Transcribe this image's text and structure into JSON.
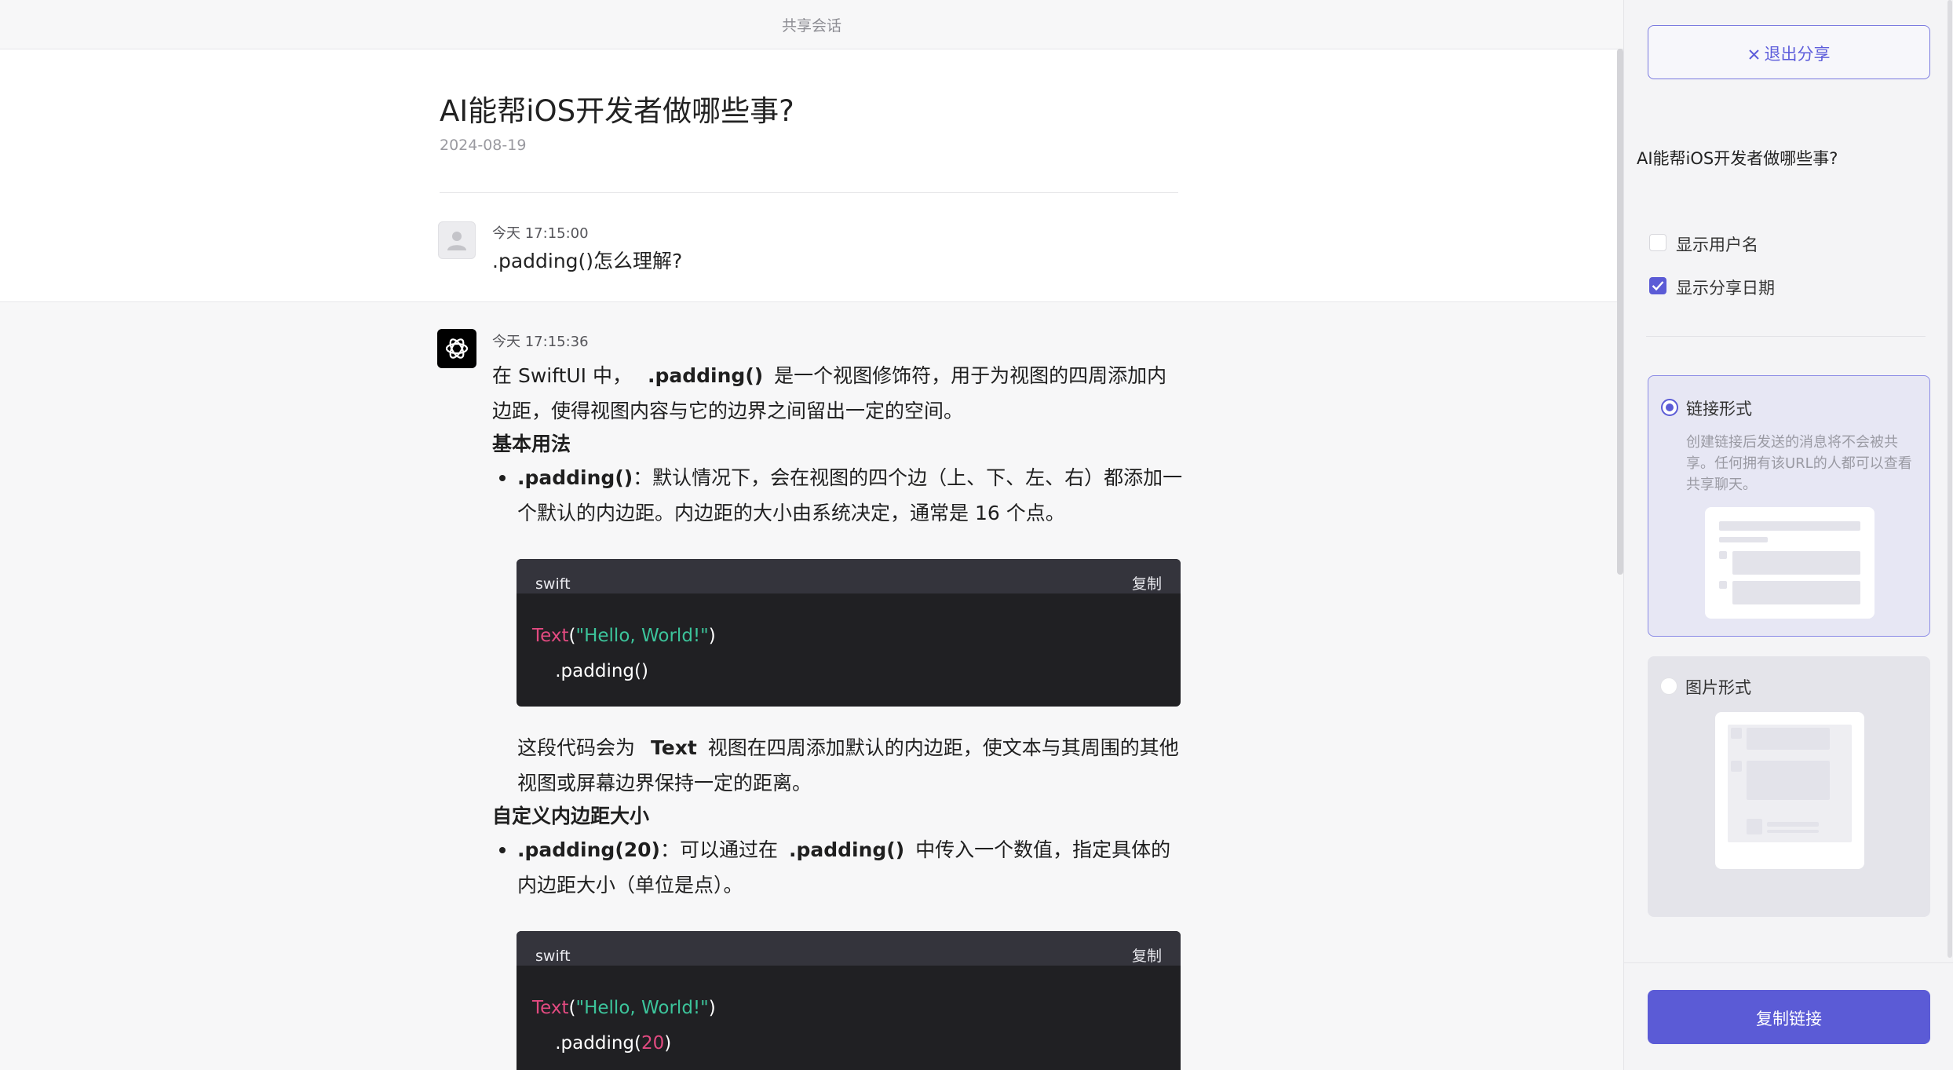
{
  "header": {
    "title": "共享会话"
  },
  "conversation": {
    "title": "AI能帮iOS开发者做哪些事?",
    "date": "2024-08-19"
  },
  "user_message": {
    "time": "今天 17:15:00",
    "text": ".padding()怎么理解?"
  },
  "ai_message": {
    "time": "今天 17:15:36",
    "intro_pre": "在 SwiftUI 中，",
    "intro_code": ".padding()",
    "intro_post": "是一个视图修饰符，用于为视图的四周添加内边距，使得视图内容与它的边界之间留出一定的空间。",
    "heading_basic": "基本用法",
    "bullet1_code": ".padding()",
    "bullet1_text": "：默认情况下，会在视图的四个边（上、下、左、右）都添加一个默认的内边距。内边距的大小由系统决定，通常是 16 个点。",
    "code1": {
      "lang": "swift",
      "copy": "复制",
      "line1_type": "Text",
      "line1_open": "(",
      "line1_str": "\"Hello, World!\"",
      "line1_close": ")",
      "line2": "    .padding()"
    },
    "para2_pre": "这段代码会为",
    "para2_code": "Text",
    "para2_post": "视图在四周添加默认的内边距，使文本与其周围的其他视图或屏幕边界保持一定的距离。",
    "heading_custom": "自定义内边距大小",
    "bullet2_code": ".padding(20)",
    "bullet2_pre": "：可以通过在",
    "bullet2_code2": ".padding()",
    "bullet2_post": "中传入一个数值，指定具体的内边距大小（单位是点）。",
    "code2": {
      "lang": "swift",
      "copy": "复制",
      "line1_type": "Text",
      "line1_open": "(",
      "line1_str": "\"Hello, World!\"",
      "line1_close": ")",
      "line2_pre": "    .padding(",
      "line2_num": "20",
      "line2_post": ")"
    }
  },
  "panel": {
    "exit_label": "退出分享",
    "title": "AI能帮iOS开发者做哪些事?",
    "show_username": {
      "label": "显示用户名",
      "checked": false
    },
    "show_date": {
      "label": "显示分享日期",
      "checked": true
    },
    "link_option": {
      "label": "链接形式",
      "selected": true,
      "description": "创建链接后发送的消息将不会被共享。任何拥有该URL的人都可以查看共享聊天。"
    },
    "image_option": {
      "label": "图片形式",
      "selected": false
    },
    "copy_link_label": "复制链接"
  },
  "colors": {
    "accent": "#5b5bd6",
    "code_bg": "#202023",
    "code_type": "#e24a80",
    "code_string": "#3cc49b"
  },
  "icons": {
    "exit": "close-icon",
    "user_avatar": "user-avatar-icon",
    "ai_avatar": "openai-logo-icon",
    "checkbox_checked": "checkmark-icon"
  }
}
